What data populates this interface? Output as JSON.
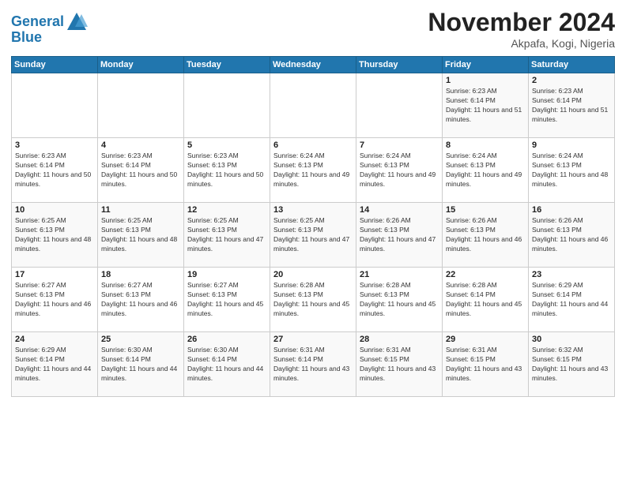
{
  "logo": {
    "line1": "General",
    "line2": "Blue"
  },
  "title": "November 2024",
  "location": "Akpafa, Kogi, Nigeria",
  "days_of_week": [
    "Sunday",
    "Monday",
    "Tuesday",
    "Wednesday",
    "Thursday",
    "Friday",
    "Saturday"
  ],
  "weeks": [
    [
      {
        "day": "",
        "info": ""
      },
      {
        "day": "",
        "info": ""
      },
      {
        "day": "",
        "info": ""
      },
      {
        "day": "",
        "info": ""
      },
      {
        "day": "",
        "info": ""
      },
      {
        "day": "1",
        "info": "Sunrise: 6:23 AM\nSunset: 6:14 PM\nDaylight: 11 hours and 51 minutes."
      },
      {
        "day": "2",
        "info": "Sunrise: 6:23 AM\nSunset: 6:14 PM\nDaylight: 11 hours and 51 minutes."
      }
    ],
    [
      {
        "day": "3",
        "info": "Sunrise: 6:23 AM\nSunset: 6:14 PM\nDaylight: 11 hours and 50 minutes."
      },
      {
        "day": "4",
        "info": "Sunrise: 6:23 AM\nSunset: 6:14 PM\nDaylight: 11 hours and 50 minutes."
      },
      {
        "day": "5",
        "info": "Sunrise: 6:23 AM\nSunset: 6:13 PM\nDaylight: 11 hours and 50 minutes."
      },
      {
        "day": "6",
        "info": "Sunrise: 6:24 AM\nSunset: 6:13 PM\nDaylight: 11 hours and 49 minutes."
      },
      {
        "day": "7",
        "info": "Sunrise: 6:24 AM\nSunset: 6:13 PM\nDaylight: 11 hours and 49 minutes."
      },
      {
        "day": "8",
        "info": "Sunrise: 6:24 AM\nSunset: 6:13 PM\nDaylight: 11 hours and 49 minutes."
      },
      {
        "day": "9",
        "info": "Sunrise: 6:24 AM\nSunset: 6:13 PM\nDaylight: 11 hours and 48 minutes."
      }
    ],
    [
      {
        "day": "10",
        "info": "Sunrise: 6:25 AM\nSunset: 6:13 PM\nDaylight: 11 hours and 48 minutes."
      },
      {
        "day": "11",
        "info": "Sunrise: 6:25 AM\nSunset: 6:13 PM\nDaylight: 11 hours and 48 minutes."
      },
      {
        "day": "12",
        "info": "Sunrise: 6:25 AM\nSunset: 6:13 PM\nDaylight: 11 hours and 47 minutes."
      },
      {
        "day": "13",
        "info": "Sunrise: 6:25 AM\nSunset: 6:13 PM\nDaylight: 11 hours and 47 minutes."
      },
      {
        "day": "14",
        "info": "Sunrise: 6:26 AM\nSunset: 6:13 PM\nDaylight: 11 hours and 47 minutes."
      },
      {
        "day": "15",
        "info": "Sunrise: 6:26 AM\nSunset: 6:13 PM\nDaylight: 11 hours and 46 minutes."
      },
      {
        "day": "16",
        "info": "Sunrise: 6:26 AM\nSunset: 6:13 PM\nDaylight: 11 hours and 46 minutes."
      }
    ],
    [
      {
        "day": "17",
        "info": "Sunrise: 6:27 AM\nSunset: 6:13 PM\nDaylight: 11 hours and 46 minutes."
      },
      {
        "day": "18",
        "info": "Sunrise: 6:27 AM\nSunset: 6:13 PM\nDaylight: 11 hours and 46 minutes."
      },
      {
        "day": "19",
        "info": "Sunrise: 6:27 AM\nSunset: 6:13 PM\nDaylight: 11 hours and 45 minutes."
      },
      {
        "day": "20",
        "info": "Sunrise: 6:28 AM\nSunset: 6:13 PM\nDaylight: 11 hours and 45 minutes."
      },
      {
        "day": "21",
        "info": "Sunrise: 6:28 AM\nSunset: 6:13 PM\nDaylight: 11 hours and 45 minutes."
      },
      {
        "day": "22",
        "info": "Sunrise: 6:28 AM\nSunset: 6:14 PM\nDaylight: 11 hours and 45 minutes."
      },
      {
        "day": "23",
        "info": "Sunrise: 6:29 AM\nSunset: 6:14 PM\nDaylight: 11 hours and 44 minutes."
      }
    ],
    [
      {
        "day": "24",
        "info": "Sunrise: 6:29 AM\nSunset: 6:14 PM\nDaylight: 11 hours and 44 minutes."
      },
      {
        "day": "25",
        "info": "Sunrise: 6:30 AM\nSunset: 6:14 PM\nDaylight: 11 hours and 44 minutes."
      },
      {
        "day": "26",
        "info": "Sunrise: 6:30 AM\nSunset: 6:14 PM\nDaylight: 11 hours and 44 minutes."
      },
      {
        "day": "27",
        "info": "Sunrise: 6:31 AM\nSunset: 6:14 PM\nDaylight: 11 hours and 43 minutes."
      },
      {
        "day": "28",
        "info": "Sunrise: 6:31 AM\nSunset: 6:15 PM\nDaylight: 11 hours and 43 minutes."
      },
      {
        "day": "29",
        "info": "Sunrise: 6:31 AM\nSunset: 6:15 PM\nDaylight: 11 hours and 43 minutes."
      },
      {
        "day": "30",
        "info": "Sunrise: 6:32 AM\nSunset: 6:15 PM\nDaylight: 11 hours and 43 minutes."
      }
    ]
  ]
}
